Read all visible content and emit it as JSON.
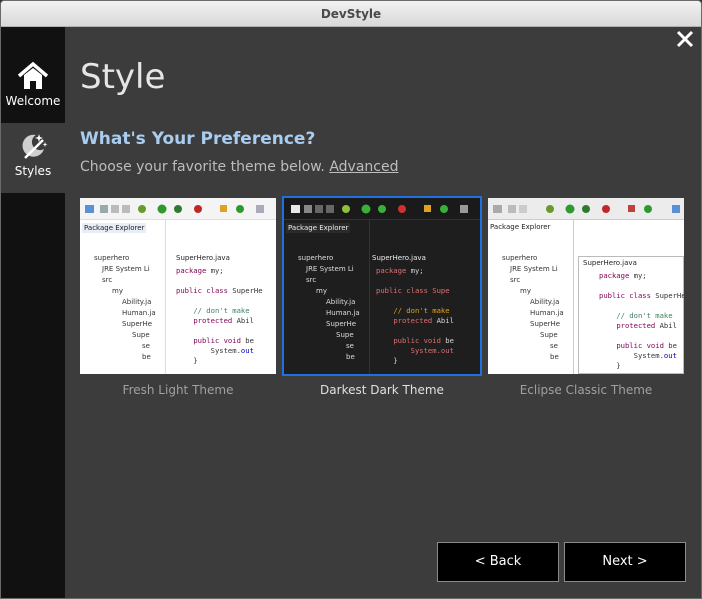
{
  "window": {
    "title": "DevStyle"
  },
  "sidebar": {
    "items": [
      {
        "label": "Welcome",
        "icon": "home-icon"
      },
      {
        "label": "Styles",
        "icon": "styles-icon"
      }
    ]
  },
  "main": {
    "title": "Style",
    "subtitle": "What's Your Preference?",
    "description": "Choose your favorite theme below.",
    "advanced_link": "Advanced"
  },
  "themes": [
    {
      "label": "Fresh Light Theme",
      "selected": false
    },
    {
      "label": "Darkest Dark Theme",
      "selected": true
    },
    {
      "label": "Eclipse Classic Theme",
      "selected": false
    }
  ],
  "preview": {
    "package_explorer_tab": "Package Explorer",
    "editor_tab": "SuperHero.java",
    "tree": [
      "superhero",
      "JRE System Li",
      "src",
      "my",
      "Ability.ja",
      "Human.ja",
      "SuperHe",
      "Supe",
      "se",
      "be"
    ],
    "code": [
      "package my;",
      "",
      "public class SuperHe",
      "",
      "    // don't make",
      "    protected Abil",
      "",
      "    public void be",
      "        System.out",
      "    }"
    ]
  },
  "buttons": {
    "back": "< Back",
    "next": "Next >"
  },
  "colors": {
    "accent": "#1f6fe0",
    "subtitle": "#a9cdf0",
    "sidebar_bg": "#111111",
    "panel_bg": "#3c3c3c"
  }
}
